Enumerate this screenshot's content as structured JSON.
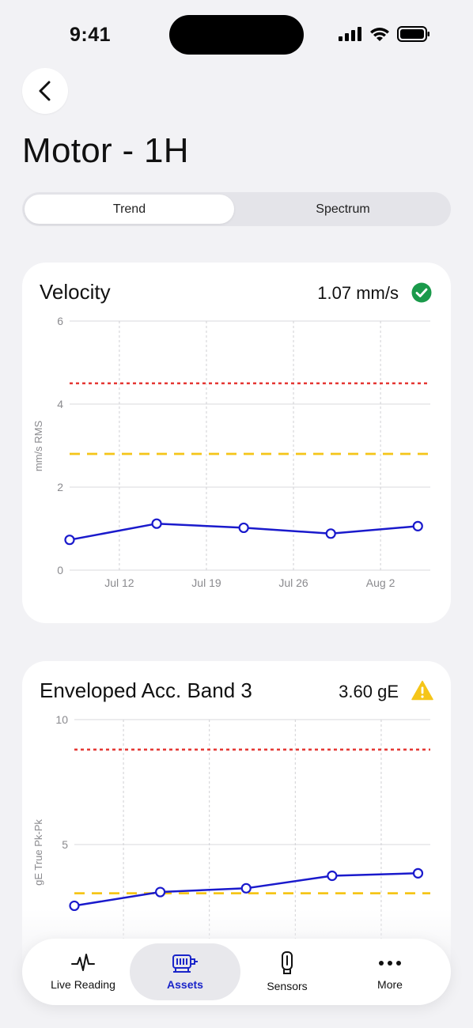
{
  "status_bar": {
    "time": "9:41"
  },
  "header": {
    "title": "Motor - 1H"
  },
  "segments": [
    {
      "label": "Trend",
      "active": true
    },
    {
      "label": "Spectrum",
      "active": false
    }
  ],
  "cards": [
    {
      "title": "Velocity",
      "value": "1.07 mm/s",
      "status": "ok",
      "status_color": "#1a9a4b"
    },
    {
      "title": "Enveloped Acc. Band 3",
      "value": "3.60 gE",
      "status": "warning",
      "status_color": "#f5c518"
    }
  ],
  "chart_data": [
    {
      "type": "line",
      "ylabel": "mm/s RMS",
      "xlabel": "",
      "ylim": [
        0,
        6
      ],
      "yticks": [
        "0",
        "2",
        "4",
        "6"
      ],
      "xticks": [
        "Jul 12",
        "Jul 19",
        "Jul 26",
        "Aug 2"
      ],
      "xlim": [
        "2024-07-08",
        "2024-08-06"
      ],
      "series": [
        {
          "x": [
            "2024-07-08",
            "2024-07-15",
            "2024-07-22",
            "2024-07-29",
            "2024-08-05"
          ],
          "y": [
            0.73,
            1.12,
            1.02,
            0.88,
            1.06
          ],
          "color": "#1a1acc"
        }
      ],
      "thresholds": [
        {
          "value": 4.5,
          "color": "#e53935",
          "style": "dotted"
        },
        {
          "value": 2.8,
          "color": "#f5c518",
          "style": "dashed"
        }
      ],
      "grid": true
    },
    {
      "type": "line",
      "ylabel": "gE True Pk-Pk",
      "xlabel": "",
      "ylim": [
        0,
        10
      ],
      "yticks": [
        "5",
        "10"
      ],
      "xticks": [],
      "xlim": [
        "2024-07-08",
        "2024-08-06"
      ],
      "series": [
        {
          "x": [
            "2024-07-08",
            "2024-07-15",
            "2024-07-22",
            "2024-07-29",
            "2024-08-05"
          ],
          "y": [
            2.55,
            3.1,
            3.25,
            3.75,
            3.85
          ],
          "color": "#1a1acc"
        }
      ],
      "thresholds": [
        {
          "value": 8.8,
          "color": "#e53935",
          "style": "dotted"
        },
        {
          "value": 3.05,
          "color": "#f5c518",
          "style": "dashed"
        }
      ],
      "grid": true
    }
  ],
  "tabbar": {
    "items": [
      {
        "label": "Live Reading",
        "icon": "pulse-icon",
        "active": false
      },
      {
        "label": "Assets",
        "icon": "motor-icon",
        "active": true
      },
      {
        "label": "Sensors",
        "icon": "sensor-icon",
        "active": false
      },
      {
        "label": "More",
        "icon": "more-icon",
        "active": false
      }
    ]
  }
}
